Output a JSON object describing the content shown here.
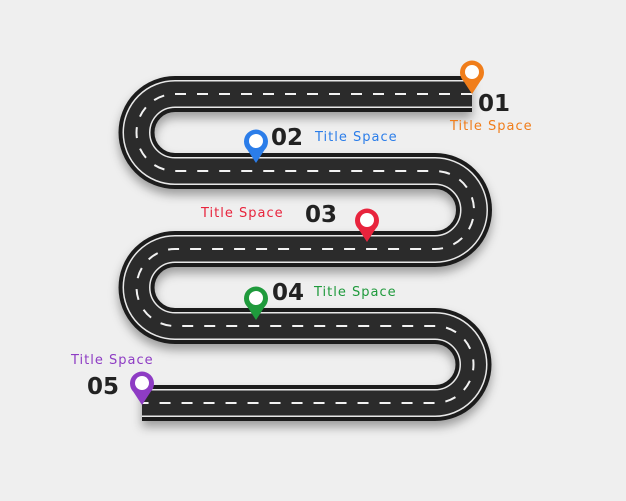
{
  "steps": [
    {
      "number": "01",
      "title": "Title Space",
      "color": "#f07d1a"
    },
    {
      "number": "02",
      "title": "Title Space",
      "color": "#2b7de9"
    },
    {
      "number": "03",
      "title": "Title Space",
      "color": "#e8243d"
    },
    {
      "number": "04",
      "title": "Title Space",
      "color": "#1f9a3c"
    },
    {
      "number": "05",
      "title": "Title Space",
      "color": "#8e3cc4"
    }
  ],
  "road": {
    "asphalt": "#2b2b2b",
    "lines": "#ffffff"
  }
}
